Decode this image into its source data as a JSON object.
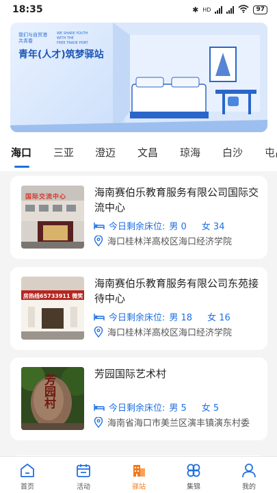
{
  "status_bar": {
    "time": "18:35",
    "network": "HD",
    "battery": "97"
  },
  "banner": {
    "small_cn_line1": "我们与自贸港",
    "small_cn_line2": "共青春",
    "small_en_line1": "WE SHARE YOUTH",
    "small_en_line2": "WITH THE",
    "small_en_line3": "FREE TRADE PORT",
    "title": "青年(人才)筑梦驿站"
  },
  "tabs": [
    "海口",
    "三亚",
    "澄迈",
    "文昌",
    "琼海",
    "白沙",
    "屯昌"
  ],
  "active_tab": "海口",
  "cards": [
    {
      "title": "海南赛伯乐教育服务有限公司国际交流中心",
      "beds_label": "今日剩余床位:",
      "male": "男 0",
      "female": "女 34",
      "address": "海口桂林洋高校区海口经济学院"
    },
    {
      "title": "海南赛伯乐教育服务有限公司东苑接待中心",
      "beds_label": "今日剩余床位:",
      "male": "男 18",
      "female": "女 16",
      "address": "海口桂林洋高校区海口经济学院"
    },
    {
      "title": "芳园国际艺术村",
      "beds_label": "今日剩余床位:",
      "male": "男 5",
      "female": "女 5",
      "address": "海南省海口市美兰区演丰镇演东村委"
    }
  ],
  "image_text": {
    "card1_sign": "国际交流中心",
    "card2_sign": "房热线65733911 微笑",
    "card3_rock": "芳园村"
  },
  "bottom_nav": [
    {
      "label": "首页",
      "icon": "home-icon"
    },
    {
      "label": "活动",
      "icon": "calendar-icon"
    },
    {
      "label": "驿站",
      "icon": "building-icon"
    },
    {
      "label": "集锦",
      "icon": "clover-icon"
    },
    {
      "label": "我的",
      "icon": "user-icon"
    }
  ],
  "active_nav": "驿站",
  "colors": {
    "accent_blue": "#1e6fe0",
    "active_orange": "#f07b1c",
    "background": "#f4f4f4"
  }
}
